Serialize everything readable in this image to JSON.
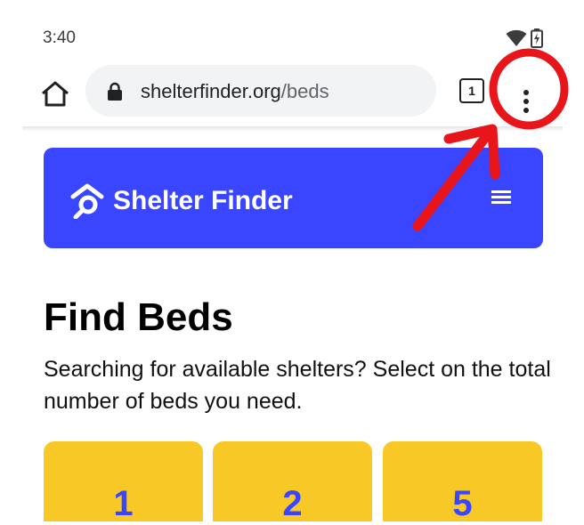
{
  "status_bar": {
    "time": "3:40",
    "icons": [
      "wifi-icon",
      "battery-charging-icon"
    ]
  },
  "browser": {
    "url_host": "shelterfinder.org",
    "url_path": "/beds",
    "tab_count": "1",
    "icons": [
      "home-icon",
      "lock-icon",
      "more-vert-icon"
    ]
  },
  "site": {
    "name": "Shelter Finder",
    "brand_color": "#3a45ff",
    "card_color": "#f8c826"
  },
  "page": {
    "title": "Find Beds",
    "description": "Searching for available shelters? Select on the total number of beds you need.",
    "bed_options": [
      "1",
      "2",
      "5"
    ]
  },
  "annotation": {
    "color": "#e8151b",
    "target": "browser-menu"
  }
}
